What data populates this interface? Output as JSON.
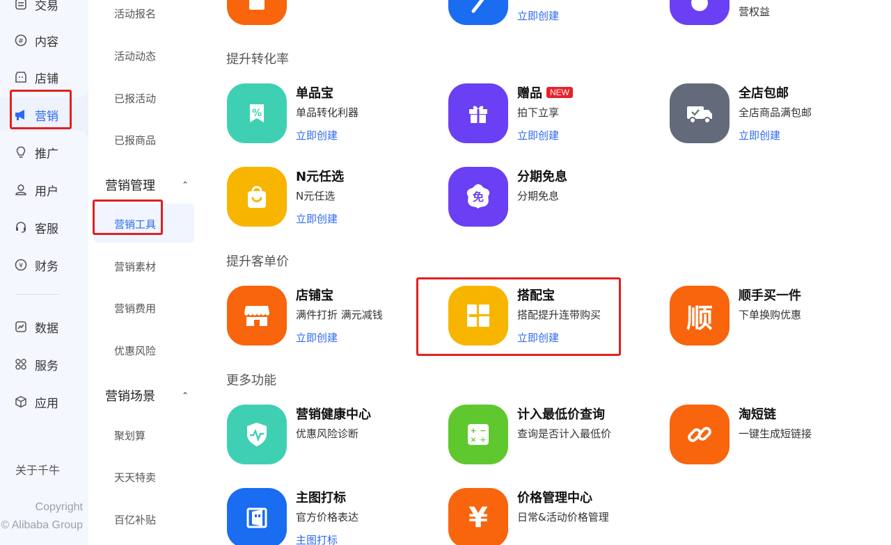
{
  "nav": {
    "items": [
      {
        "label": "交易",
        "icon": "trade-icon"
      },
      {
        "label": "内容",
        "icon": "content-icon"
      },
      {
        "label": "店铺",
        "icon": "store-icon"
      },
      {
        "label": "营销",
        "icon": "megaphone-icon",
        "active": true
      },
      {
        "label": "推广",
        "icon": "bulb-icon"
      },
      {
        "label": "用户",
        "icon": "user-icon"
      },
      {
        "label": "客服",
        "icon": "headset-icon"
      },
      {
        "label": "财务",
        "icon": "yuan-icon"
      },
      {
        "label": "数据",
        "icon": "chart-icon"
      },
      {
        "label": "服务",
        "icon": "grid-icon"
      },
      {
        "label": "应用",
        "icon": "cube-icon"
      }
    ],
    "about": "关于千牛",
    "copyright_line1": "Copyright",
    "copyright_line2": "© Alibaba Group"
  },
  "subnav": {
    "items_top": [
      "活动报名",
      "活动动态",
      "已报活动",
      "已报商品"
    ],
    "group1": {
      "title": "营销管理",
      "items": [
        "营销工具",
        "营销素材",
        "营销费用",
        "优惠风险"
      ]
    },
    "group2": {
      "title": "营销场景",
      "items": [
        "聚划算",
        "天天特卖",
        "百亿补贴"
      ]
    }
  },
  "sections": {
    "conversion": "提升转化率",
    "order_value": "提升客单价",
    "more": "更多功能"
  },
  "top_partial": {
    "link2": "立即创建",
    "desc3": "营权益"
  },
  "tools": {
    "danpinbao": {
      "name": "单品宝",
      "desc": "单品转化利器",
      "link": "立即创建"
    },
    "zengpin": {
      "name": "赠品",
      "badge": "NEW",
      "desc": "拍下立享",
      "link": "立即创建"
    },
    "quandian": {
      "name": "全店包邮",
      "desc": "全店商品满包邮",
      "link": "立即创建"
    },
    "nyuan": {
      "name": "N元任选",
      "desc": "N元任选",
      "link": "立即创建"
    },
    "fenqi": {
      "name": "分期免息",
      "desc": "分期免息"
    },
    "dianpubao": {
      "name": "店铺宝",
      "desc": "满件打折 满元减钱",
      "link": "立即创建"
    },
    "dapeibao": {
      "name": "搭配宝",
      "desc": "搭配提升连带购买",
      "link": "立即创建"
    },
    "shunshou": {
      "name": "顺手买一件",
      "desc": "下单换购优惠"
    },
    "jiankang": {
      "name": "营销健康中心",
      "desc": "优惠风险诊断"
    },
    "zuidijia": {
      "name": "计入最低价查询",
      "desc": "查询是否计入最低价"
    },
    "duanlian": {
      "name": "淘短链",
      "desc": "一键生成短链接"
    },
    "zhutu": {
      "name": "主图打标",
      "desc": "官方价格表达",
      "link": "主图打标"
    },
    "jiage": {
      "name": "价格管理中心",
      "desc": "日常&活动价格管理"
    }
  },
  "colors": {
    "accent": "#2c68f5",
    "teal": "#3fd0b3",
    "purple": "#6b3ff3",
    "gray": "#636b7a",
    "yellow": "#f8b500",
    "orange": "#f8650c",
    "green": "#5ec82e",
    "blue": "#1a6cf0",
    "highlight": "#e02020"
  }
}
